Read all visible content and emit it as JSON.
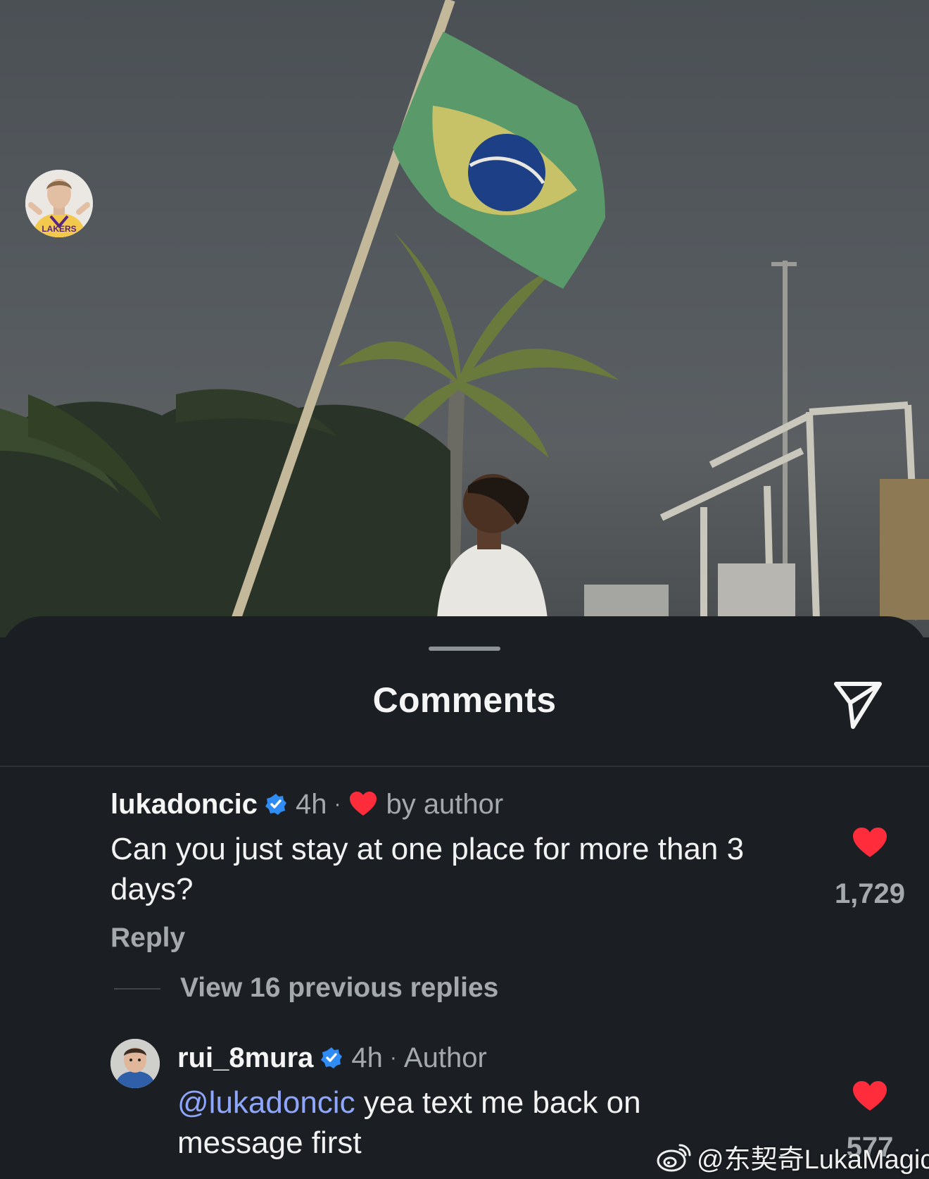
{
  "sheet": {
    "title": "Comments",
    "share_icon": "send-icon"
  },
  "comments": [
    {
      "username": "lukadoncic",
      "verified": true,
      "time": "4h",
      "separator": "·",
      "liked_by_author_label": "by author",
      "text": "Can you just stay at one place for more than 3 days?",
      "reply_label": "Reply",
      "like_count": "1,729",
      "liked": true,
      "view_replies_label": "View 16 previous replies"
    },
    {
      "username": "rui_8mura",
      "verified": true,
      "time": "4h",
      "separator": "·",
      "author_label": "Author",
      "mention": "@lukadoncic",
      "text": " yea text me back on message first",
      "like_count": "577",
      "liked": true
    }
  ],
  "watermark": {
    "text": "@东契奇LukaMagic",
    "logo": "weibo-logo-icon"
  },
  "colors": {
    "sheet_bg": "#1b1f23",
    "heart": "#ff2d3c",
    "verified": "#2f8cf4",
    "mention": "#8fa6ff",
    "secondary_text": "#a4a9ae"
  }
}
